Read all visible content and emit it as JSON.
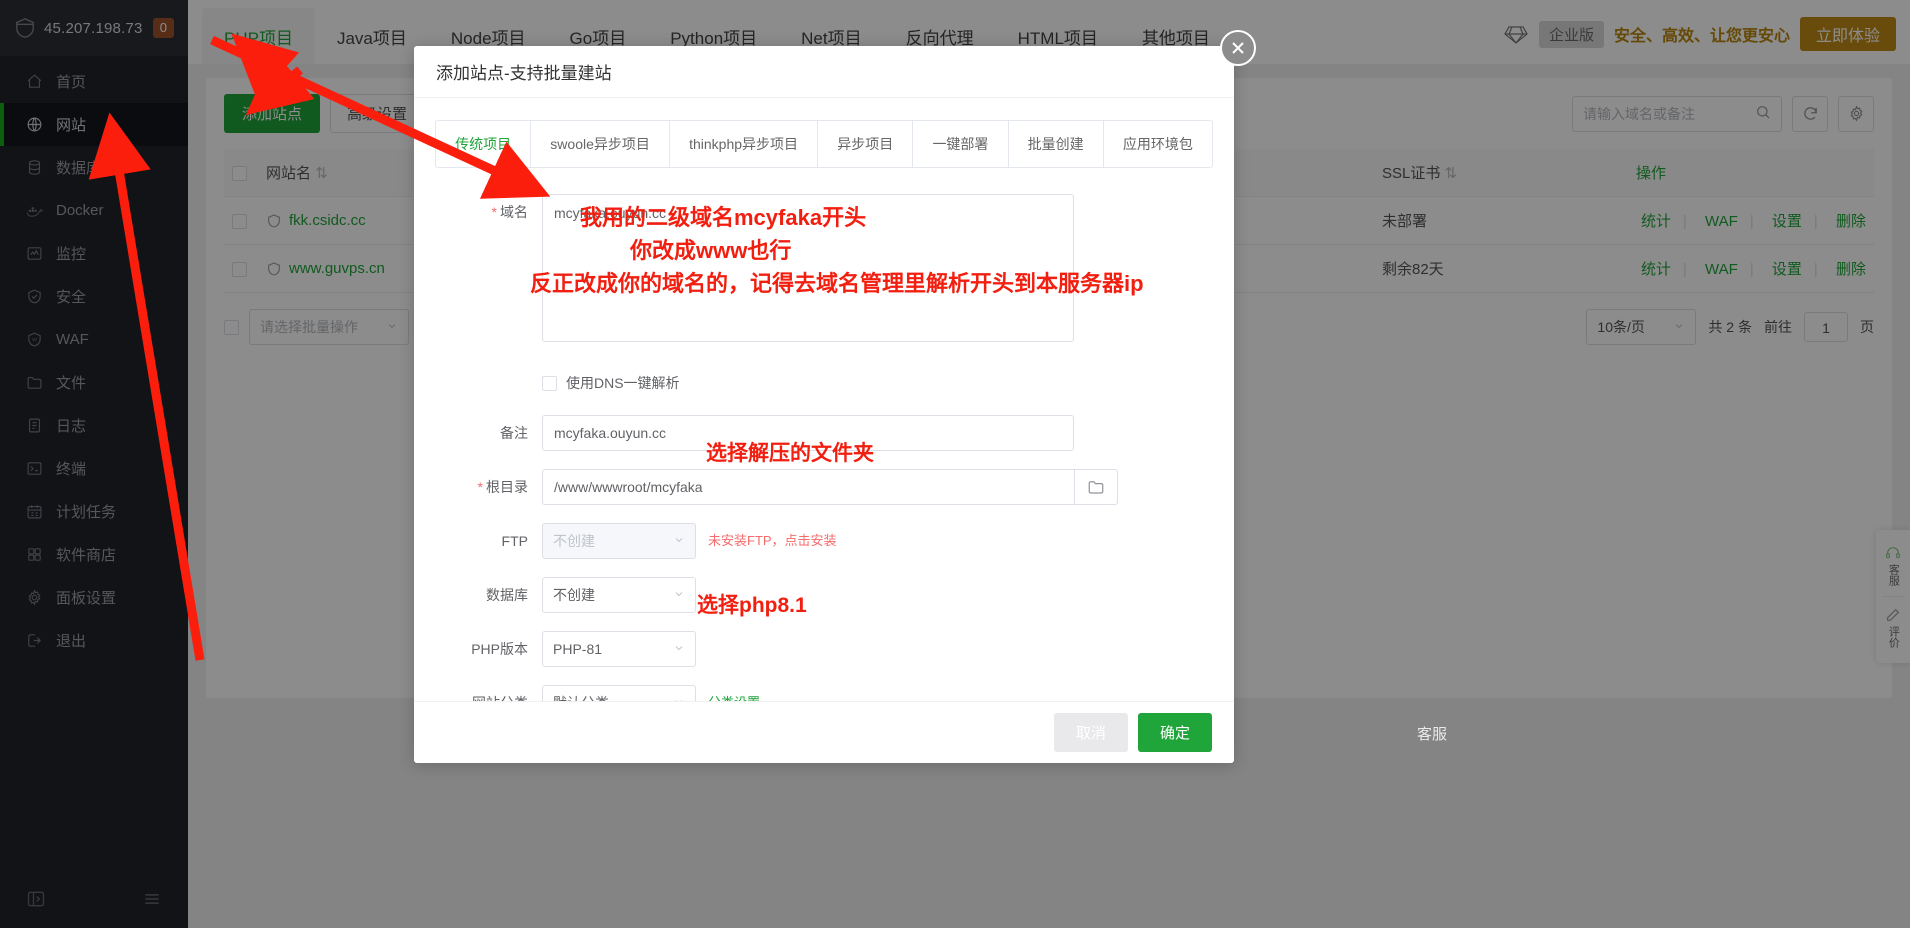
{
  "sidebar": {
    "ip": "45.207.198.73",
    "badge": "0",
    "items": [
      {
        "label": "首页",
        "icon": "home-icon",
        "active": false
      },
      {
        "label": "网站",
        "icon": "globe-icon",
        "active": true
      },
      {
        "label": "数据库",
        "icon": "database-icon",
        "active": false
      },
      {
        "label": "Docker",
        "icon": "docker-icon",
        "active": false
      },
      {
        "label": "监控",
        "icon": "monitor-icon",
        "active": false
      },
      {
        "label": "安全",
        "icon": "shield-icon",
        "active": false
      },
      {
        "label": "WAF",
        "icon": "waf-icon",
        "active": false
      },
      {
        "label": "文件",
        "icon": "folder-icon",
        "active": false
      },
      {
        "label": "日志",
        "icon": "log-icon",
        "active": false
      },
      {
        "label": "终端",
        "icon": "terminal-icon",
        "active": false
      },
      {
        "label": "计划任务",
        "icon": "calendar-icon",
        "active": false
      },
      {
        "label": "软件商店",
        "icon": "apps-icon",
        "active": false
      },
      {
        "label": "面板设置",
        "icon": "gear-icon",
        "active": false
      },
      {
        "label": "退出",
        "icon": "logout-icon",
        "active": false
      }
    ],
    "footer": {
      "collapse_icon": "collapse-icon",
      "menu_icon": "menu-icon"
    }
  },
  "topbar": {
    "tabs": [
      {
        "label": "PHP项目",
        "active": true
      },
      {
        "label": "Java项目",
        "active": false
      },
      {
        "label": "Node项目",
        "active": false
      },
      {
        "label": "Go项目",
        "active": false
      },
      {
        "label": "Python项目",
        "active": false
      },
      {
        "label": "Net项目",
        "active": false
      },
      {
        "label": "反向代理",
        "active": false
      },
      {
        "label": "HTML项目",
        "active": false
      },
      {
        "label": "其他项目",
        "active": false
      }
    ],
    "promo": {
      "gem_icon": "gem-icon",
      "pill": "企业版",
      "slogan": "安全、高效、让您更安心",
      "button": "立即体验",
      "accent": "#c08a16"
    }
  },
  "content": {
    "toolbar": {
      "add_site": "添加站点",
      "advanced": "高级设置",
      "search_placeholder": "请输入域名或备注",
      "search_icon": "search-icon",
      "refresh_icon": "refresh-icon",
      "settings_icon": "gear-icon"
    },
    "table": {
      "columns": [
        "网站名",
        "SSL证书",
        "操作"
      ],
      "rows": [
        {
          "name": "fkk.csidc.cc",
          "ssl": "未部署",
          "ssl_state": "warn",
          "ops": [
            "统计",
            "WAF",
            "设置",
            "删除"
          ]
        },
        {
          "name": "www.guvps.cn",
          "ssl": "剩余82天",
          "ssl_state": "ok",
          "ops": [
            "统计",
            "WAF",
            "设置",
            "删除"
          ]
        }
      ]
    },
    "batch": {
      "placeholder": "请选择批量操作"
    },
    "pager": {
      "page_size": "10条/页",
      "total": "共 2 条",
      "goto": "前往",
      "page": "1",
      "unit": "页"
    }
  },
  "right_dock": [
    {
      "icon": "headset-icon",
      "label": "客服"
    },
    {
      "icon": "pencil-icon",
      "label": "评价"
    }
  ],
  "floating": {
    "service_label": "客服"
  },
  "modal": {
    "title": "添加站点-支持批量建站",
    "close_icon": "close-icon",
    "tabs": [
      {
        "label": "传统项目",
        "active": true
      },
      {
        "label": "swoole异步项目",
        "active": false
      },
      {
        "label": "thinkphp异步项目",
        "active": false
      },
      {
        "label": "异步项目",
        "active": false
      },
      {
        "label": "一键部署",
        "active": false
      },
      {
        "label": "批量创建",
        "active": false
      },
      {
        "label": "应用环境包",
        "active": false
      }
    ],
    "fields": {
      "domain": {
        "label": "域名",
        "required": true,
        "value": "mcyfaka.ouyun.cc"
      },
      "dns": {
        "label": "使用DNS一键解析",
        "checked": false
      },
      "remark": {
        "label": "备注",
        "required": false,
        "value": "mcyfaka.ouyun.cc"
      },
      "root_dir": {
        "label": "根目录",
        "required": true,
        "value": "/www/wwwroot/mcyfaka",
        "browse_icon": "folder-open-icon"
      },
      "ftp": {
        "label": "FTP",
        "value": "不创建",
        "disabled": true,
        "note": "未安装FTP，点击安装"
      },
      "database": {
        "label": "数据库",
        "value": "不创建"
      },
      "php": {
        "label": "PHP版本",
        "value": "PHP-81"
      },
      "category": {
        "label": "网站分类",
        "value": "默认分类",
        "link": "分类设置"
      }
    },
    "footer": {
      "cancel": "取消",
      "confirm": "确定"
    }
  },
  "annotations": {
    "domain_line1": "我用的二级域名mcyfaka开头",
    "domain_line2": "你改成www也行",
    "domain_line3": "反正改成你的域名的，记得去域名管理里解析开头到本服务器ip",
    "root_dir": "选择解压的文件夹",
    "php": "选择php8.1",
    "color": "#f21f10"
  }
}
